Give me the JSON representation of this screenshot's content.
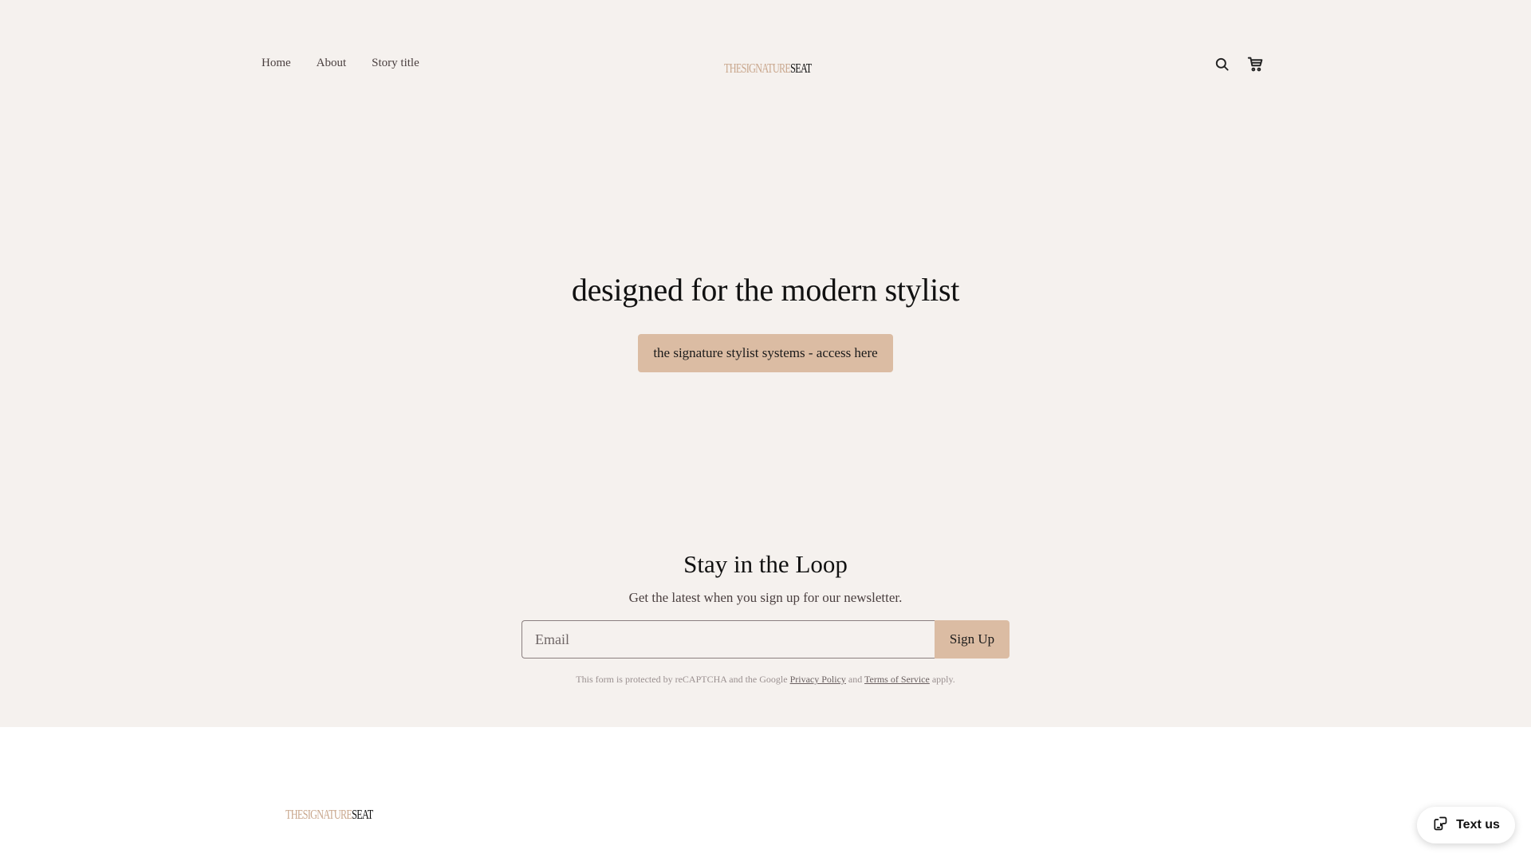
{
  "header": {
    "nav": [
      {
        "label": "Home"
      },
      {
        "label": "About"
      },
      {
        "label": "Story title"
      }
    ],
    "logo": {
      "light_text": "THESIGNATURE",
      "dark_text": "SEAT"
    },
    "icons": [
      "search-icon",
      "cart-icon"
    ]
  },
  "hero": {
    "title": "designed for the modern stylist",
    "button_label": "the signature stylist systems - access here"
  },
  "newsletter": {
    "title": "Stay in the Loop",
    "subtitle": "Get the latest when you sign up for our newsletter.",
    "email_placeholder": "Email",
    "email_value": "",
    "button_label": "Sign Up",
    "recaptcha_prefix": "This form is protected by reCAPTCHA and the Google",
    "privacy_link": "Privacy Policy",
    "and_text": "and",
    "terms_link": "Terms of Service",
    "suffix": "apply."
  },
  "footer": {
    "logo": {
      "light_text": "THESIGNATURE",
      "dark_text": "SEAT"
    }
  },
  "chat_widget": {
    "label": "Text us",
    "icon": "chat-phone-icon"
  },
  "colors": {
    "background": "#f5f1ee",
    "accent": "#dbbca3",
    "logo_light": "#c9a78d",
    "footer_background": "#ffffff"
  }
}
